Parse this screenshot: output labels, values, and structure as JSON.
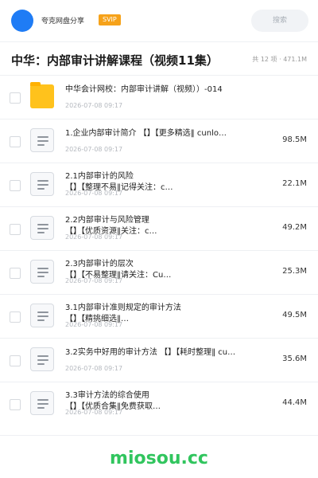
{
  "header": {
    "username": "夸克网盘分享",
    "badge": "SVIP",
    "search_placeholder": "搜索"
  },
  "folder": {
    "title": "中华：内部审计讲解课程（视频11集）",
    "meta": "共 12 项 · 471.1M"
  },
  "items": [
    {
      "type": "folder",
      "name": "中华会计网校：内部审计讲解（视频））-014",
      "date": "2026-07-08 09:17",
      "size": "",
      "icon": "folder-icon"
    },
    {
      "type": "file",
      "name": "1.企业内部审计简介 【】【更多精选‖ cunlo…",
      "date": "2026-07-08 09:17",
      "size": "98.5M",
      "icon": "document-icon"
    },
    {
      "type": "file",
      "name": "2.1内部审计的风险\n【】【整理不易‖记得关注：c…",
      "date": "2026-07-08 09:17",
      "size": "22.1M",
      "icon": "document-icon"
    },
    {
      "type": "file",
      "name": "2.2内部审计与风险管理\n【】【优质资源‖关注：c…",
      "date": "2026-07-08 09:17",
      "size": "49.2M",
      "icon": "document-icon"
    },
    {
      "type": "file",
      "name": "2.3内部审计的层次\n【】【不易整理‖请关注：Cu…",
      "date": "2026-07-08 09:17",
      "size": "25.3M",
      "icon": "document-icon"
    },
    {
      "type": "file",
      "name": "3.1内部审计准则规定的审计方法\n【】【精挑细选‖…",
      "date": "2026-07-08 09:17",
      "size": "49.5M",
      "icon": "document-icon"
    },
    {
      "type": "file",
      "name": "3.2实务中好用的审计方法 【】【耗时整理‖ cu…",
      "date": "2026-07-08 09:17",
      "size": "35.6M",
      "icon": "document-icon"
    },
    {
      "type": "file",
      "name": "3.3审计方法的综合使用\n【】【优质合集‖免费获取…",
      "date": "2026-07-08 09:17",
      "size": "44.4M",
      "icon": "document-icon"
    }
  ],
  "footer": {
    "brand": "miosou.cc"
  },
  "colors": {
    "accent": "#1f7cf5",
    "svip": "#f6a21a",
    "brand": "#31c55e",
    "folder": "#ffc21c"
  }
}
